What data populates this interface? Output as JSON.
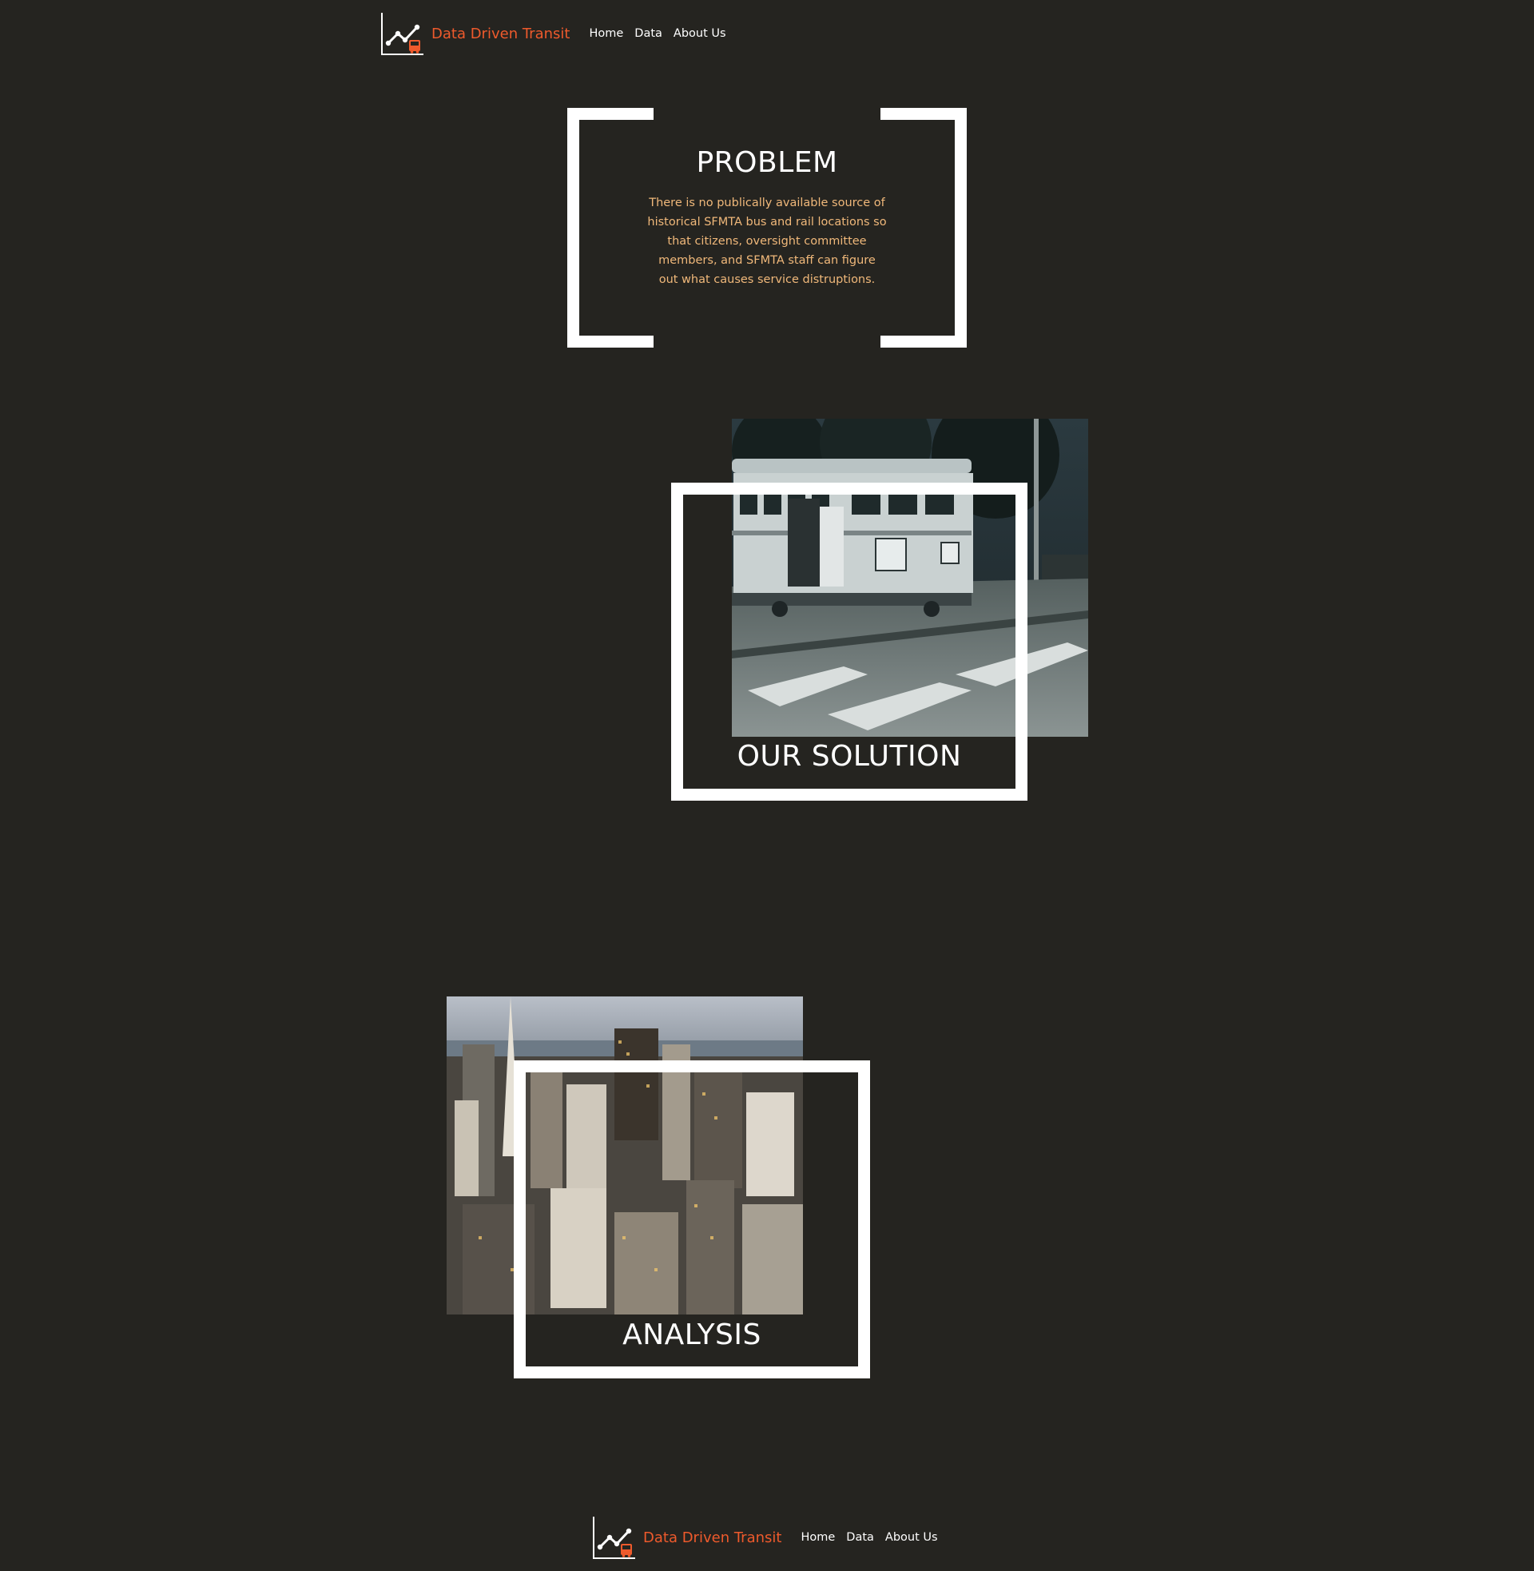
{
  "header": {
    "logo_icon": "chart-bus-logo-icon",
    "brand": "Data Driven Transit",
    "nav": [
      {
        "label": "Home"
      },
      {
        "label": "Data"
      },
      {
        "label": "About Us"
      }
    ]
  },
  "problem": {
    "title": "PROBLEM",
    "text": "There is no publically available source of historical SFMTA bus and rail locations so that citizens, oversight committee members, and SFMTA staff can figure out what causes service distruptions."
  },
  "solution": {
    "label": "OUR SOLUTION"
  },
  "analysis": {
    "label": "ANALYSIS"
  },
  "footer": {
    "brand": "Data Driven Transit",
    "nav": [
      {
        "label": "Home"
      },
      {
        "label": "Data"
      },
      {
        "label": "About Us"
      }
    ]
  },
  "colors": {
    "background": "#252420",
    "brand": "#ee5a2c",
    "problem_text": "#f0b87a",
    "frame": "#ffffff"
  }
}
